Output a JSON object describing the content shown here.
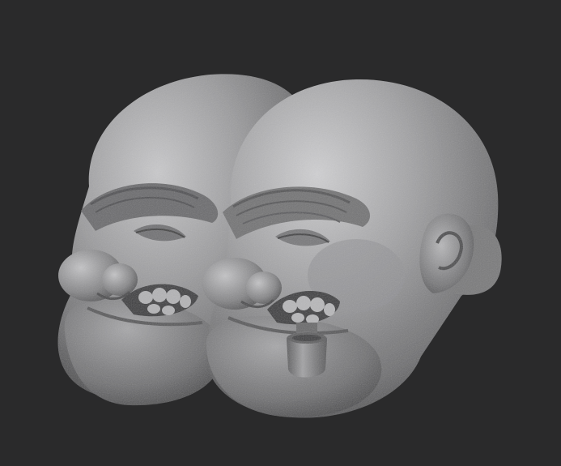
{
  "scene": {
    "background_color": "#2a2a2b",
    "material_color": "#8a8a8c",
    "subjects": [
      {
        "name": "sculpt-head-back",
        "props": []
      },
      {
        "name": "sculpt-head-front",
        "props": [
          "pipe"
        ]
      }
    ]
  }
}
